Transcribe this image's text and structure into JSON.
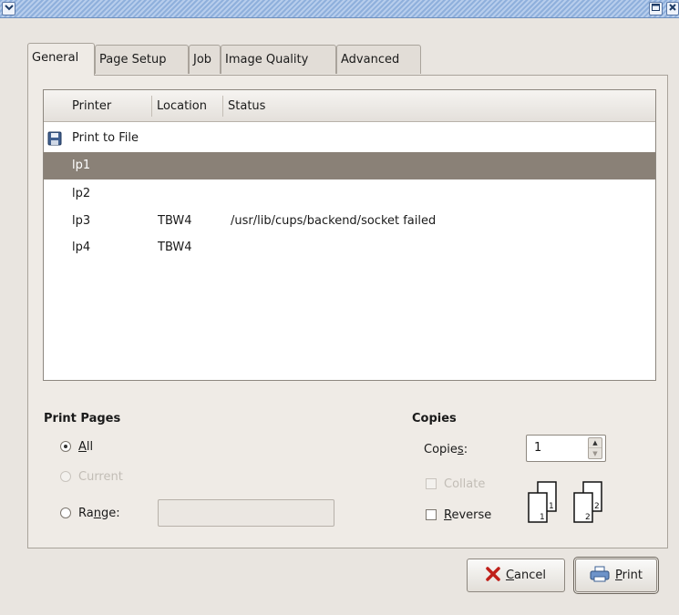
{
  "window": {
    "menu_icon": "chevron-down-icon",
    "maximize_icon": "maximize-icon",
    "close_icon": "close-icon"
  },
  "tabs": [
    {
      "label": "General",
      "active": true
    },
    {
      "label": "Page Setup",
      "active": false
    },
    {
      "label": "Job",
      "active": false
    },
    {
      "label": "Image Quality",
      "active": false
    },
    {
      "label": "Advanced",
      "active": false
    }
  ],
  "printer_list": {
    "columns": [
      "Printer",
      "Location",
      "Status"
    ],
    "rows": [
      {
        "printer": "Print to File",
        "location": "",
        "status": "",
        "icon": "floppy-disk-icon",
        "selected": false
      },
      {
        "printer": "lp1",
        "location": "",
        "status": "",
        "selected": true
      },
      {
        "printer": "lp2",
        "location": "",
        "status": "",
        "selected": false
      },
      {
        "printer": "lp3",
        "location": "TBW4",
        "status": "/usr/lib/cups/backend/socket failed",
        "selected": false
      },
      {
        "printer": "lp4",
        "location": "TBW4",
        "status": "",
        "selected": false
      }
    ]
  },
  "print_pages": {
    "title": "Print Pages",
    "all": {
      "mnemonic": "A",
      "rest": "ll",
      "selected": true
    },
    "current": {
      "label": "Current",
      "enabled": false
    },
    "range": {
      "pre": "Ra",
      "mnemonic": "n",
      "post": "ge:",
      "value": ""
    }
  },
  "copies": {
    "title": "Copies",
    "label": {
      "pre": "Copie",
      "mnemonic": "s",
      "post": ":"
    },
    "value": "1",
    "collate": {
      "label": "Collate",
      "enabled": false
    },
    "reverse": {
      "mnemonic": "R",
      "rest": "everse",
      "checked": false
    },
    "collate_icon": "collate-pages-icon"
  },
  "buttons": {
    "cancel": {
      "mnemonic": "C",
      "rest": "ancel",
      "icon": "cancel-x-icon"
    },
    "print": {
      "mnemonic": "P",
      "rest": "rint",
      "icon": "printer-icon"
    }
  }
}
